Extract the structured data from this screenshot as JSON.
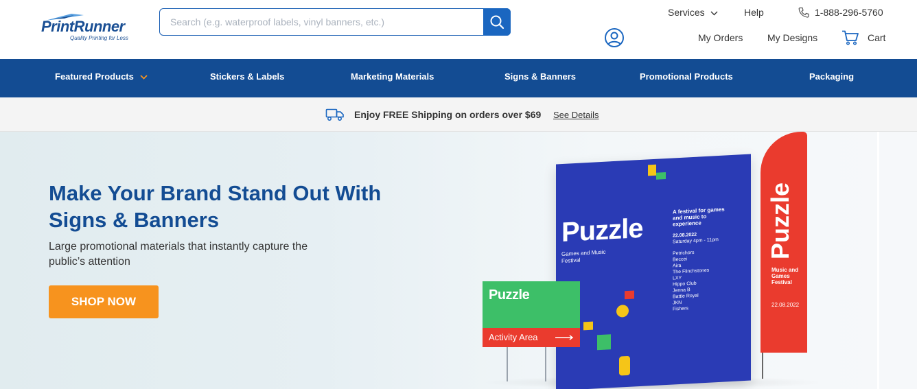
{
  "header": {
    "logo_text": "PrintRunner",
    "logo_tagline": "Quality Printing for Less",
    "search": {
      "placeholder": "Search (e.g. waterproof labels, vinyl banners, etc.)"
    },
    "links": {
      "services": "Services",
      "help": "Help",
      "phone": "1-888-296-5760",
      "my_orders": "My Orders",
      "my_designs": "My Designs",
      "cart": "Cart"
    },
    "icons": {
      "search": "search-icon",
      "phone": "phone-icon",
      "account": "account-icon",
      "cart": "cart-icon",
      "services_chevron": "chevron-down-icon"
    }
  },
  "nav": {
    "items": [
      {
        "label": "Featured Products",
        "has_dropdown": true
      },
      {
        "label": "Stickers & Labels"
      },
      {
        "label": "Marketing Materials"
      },
      {
        "label": "Signs & Banners"
      },
      {
        "label": "Promotional Products"
      },
      {
        "label": "Packaging"
      }
    ]
  },
  "shipping": {
    "text": "Enjoy FREE Shipping on orders over $69",
    "link": "See Details",
    "icon": "truck-icon"
  },
  "hero": {
    "title": "Make Your Brand Stand Out With Signs & Banners",
    "subtitle": "Large promotional materials that instantly capture the public’s attention",
    "cta": "SHOP NOW",
    "image": {
      "board_title": "Puzzle",
      "board_subtitle": "Games and Music Festival",
      "board_tagline": "A festival for games and music to experience",
      "board_date": "22.08.2022",
      "board_time": "Saturday 4pm - 11pm",
      "board_lineup": [
        "Petrichors",
        "Beccei",
        "Aira",
        "The Flinchstones",
        "LXY",
        "Hippo Club",
        "Jenna B",
        "Battle Royal",
        "JKN",
        "Fishers"
      ],
      "flag_title": "Puzzle",
      "flag_subtitle": "Music and Games Festival",
      "flag_date": "22.08.2022",
      "yard_title": "Puzzle",
      "yard_banner": "Activity Area"
    }
  },
  "colors": {
    "brand_blue": "#134c93",
    "search_blue": "#1a66c0",
    "cta_orange": "#f7931e",
    "nav_chevron": "#f7931e"
  }
}
